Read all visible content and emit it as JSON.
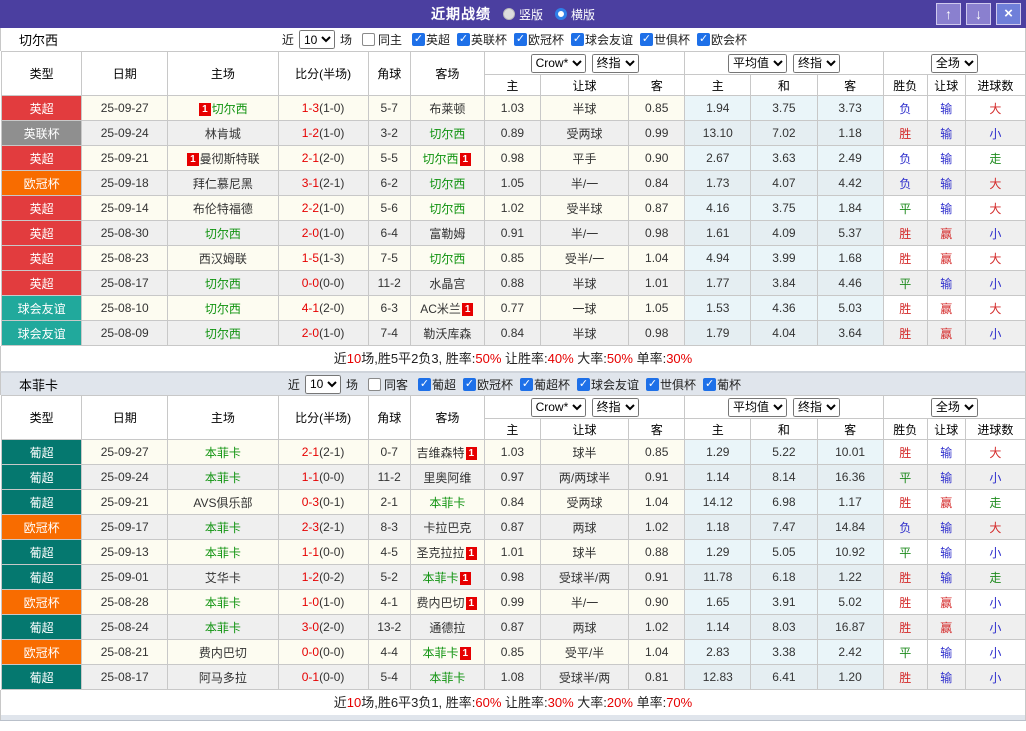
{
  "titlebar": {
    "title": "近期战绩",
    "radios": [
      {
        "label": "竖版",
        "selected": false
      },
      {
        "label": "横版",
        "selected": true
      }
    ],
    "buttons": [
      {
        "name": "up",
        "glyph": "↑"
      },
      {
        "name": "down",
        "glyph": "↓"
      },
      {
        "name": "close",
        "glyph": "×"
      }
    ]
  },
  "filter": {
    "prefix": "近",
    "matches_select": "10",
    "suffix": "场"
  },
  "table_header": {
    "static_cols": [
      "类型",
      "日期",
      "主场",
      "比分(半场)",
      "角球",
      "客场"
    ],
    "odds_group": {
      "selects": [
        "Crow*",
        "终指"
      ],
      "cols": [
        "主",
        "让球",
        "客"
      ]
    },
    "avg_group": {
      "selects": [
        "平均值",
        "终指"
      ],
      "cols": [
        "主",
        "和",
        "客"
      ]
    },
    "full_group": {
      "selects": [
        "全场"
      ],
      "cols": [
        "胜负",
        "让球",
        "进球数"
      ]
    }
  },
  "colors": {
    "titlebar": "#4b3fa0",
    "titlebar_button": "#8a80cf",
    "close_button": "#6f7fd9",
    "checkbox_blue": "#1e70e8",
    "focal_team_green": "#109310",
    "score_red": "#e60000",
    "red_card_badge": "#e60000",
    "summary_red": "#e60000"
  },
  "type_colors": {
    "英超": "#e23c3e",
    "英联杯": "#8f8f8f",
    "欧冠杯": "#f86c00",
    "球会友谊": "#21a99c",
    "葡超": "#05786f"
  },
  "result_colors": {
    "red": "#d42a2a",
    "blue": "#2d2dcc",
    "green": "#1d8a1d"
  },
  "result_color_map": {
    "胜": "red",
    "赢": "red",
    "大": "red",
    "负": "blue",
    "输": "blue",
    "小": "blue",
    "平": "green",
    "走": "green"
  },
  "sections": [
    {
      "team": "切尔西",
      "same_side_label": "同主",
      "leagues": [
        "英超",
        "英联杯",
        "欧冠杯",
        "球会友谊",
        "世俱杯",
        "欧会杯"
      ],
      "rows": [
        {
          "type": "英超",
          "date": "25-09-27",
          "home": {
            "name": "切尔西",
            "focal": true,
            "card_before": "1"
          },
          "score": "1-3",
          "half": "(1-0)",
          "corner": "5-7",
          "away": {
            "name": "布莱顿"
          },
          "odds": [
            "1.03",
            "半球",
            "0.85"
          ],
          "avg": [
            "1.94",
            "3.75",
            "3.73"
          ],
          "result": [
            "负",
            "输",
            "大"
          ]
        },
        {
          "type": "英联杯",
          "date": "25-09-24",
          "home": {
            "name": "林肯城"
          },
          "score": "1-2",
          "half": "(1-0)",
          "corner": "3-2",
          "away": {
            "name": "切尔西",
            "focal": true
          },
          "odds": [
            "0.89",
            "受两球",
            "0.99"
          ],
          "avg": [
            "13.10",
            "7.02",
            "1.18"
          ],
          "result": [
            "胜",
            "输",
            "小"
          ]
        },
        {
          "type": "英超",
          "date": "25-09-21",
          "home": {
            "name": "曼彻斯特联",
            "card_before": "1"
          },
          "score": "2-1",
          "half": "(2-0)",
          "corner": "5-5",
          "away": {
            "name": "切尔西",
            "focal": true,
            "card_after": "1"
          },
          "odds": [
            "0.98",
            "平手",
            "0.90"
          ],
          "avg": [
            "2.67",
            "3.63",
            "2.49"
          ],
          "result": [
            "负",
            "输",
            "走"
          ]
        },
        {
          "type": "欧冠杯",
          "date": "25-09-18",
          "home": {
            "name": "拜仁慕尼黑"
          },
          "score": "3-1",
          "half": "(2-1)",
          "corner": "6-2",
          "away": {
            "name": "切尔西",
            "focal": true
          },
          "odds": [
            "1.05",
            "半/一",
            "0.84"
          ],
          "avg": [
            "1.73",
            "4.07",
            "4.42"
          ],
          "result": [
            "负",
            "输",
            "大"
          ]
        },
        {
          "type": "英超",
          "date": "25-09-14",
          "home": {
            "name": "布伦特福德"
          },
          "score": "2-2",
          "half": "(1-0)",
          "corner": "5-6",
          "away": {
            "name": "切尔西",
            "focal": true
          },
          "odds": [
            "1.02",
            "受半球",
            "0.87"
          ],
          "avg": [
            "4.16",
            "3.75",
            "1.84"
          ],
          "result": [
            "平",
            "输",
            "大"
          ]
        },
        {
          "type": "英超",
          "date": "25-08-30",
          "home": {
            "name": "切尔西",
            "focal": true
          },
          "score": "2-0",
          "half": "(1-0)",
          "corner": "6-4",
          "away": {
            "name": "富勒姆"
          },
          "odds": [
            "0.91",
            "半/一",
            "0.98"
          ],
          "avg": [
            "1.61",
            "4.09",
            "5.37"
          ],
          "result": [
            "胜",
            "赢",
            "小"
          ]
        },
        {
          "type": "英超",
          "date": "25-08-23",
          "home": {
            "name": "西汉姆联"
          },
          "score": "1-5",
          "half": "(1-3)",
          "corner": "7-5",
          "away": {
            "name": "切尔西",
            "focal": true
          },
          "odds": [
            "0.85",
            "受半/一",
            "1.04"
          ],
          "avg": [
            "4.94",
            "3.99",
            "1.68"
          ],
          "result": [
            "胜",
            "赢",
            "大"
          ]
        },
        {
          "type": "英超",
          "date": "25-08-17",
          "home": {
            "name": "切尔西",
            "focal": true
          },
          "score": "0-0",
          "half": "(0-0)",
          "corner": "11-2",
          "away": {
            "name": "水晶宫"
          },
          "odds": [
            "0.88",
            "半球",
            "1.01"
          ],
          "avg": [
            "1.77",
            "3.84",
            "4.46"
          ],
          "result": [
            "平",
            "输",
            "小"
          ]
        },
        {
          "type": "球会友谊",
          "date": "25-08-10",
          "home": {
            "name": "切尔西",
            "focal": true
          },
          "score": "4-1",
          "half": "(2-0)",
          "corner": "6-3",
          "away": {
            "name": "AC米兰",
            "card_after": "1"
          },
          "odds": [
            "0.77",
            "一球",
            "1.05"
          ],
          "avg": [
            "1.53",
            "4.36",
            "5.03"
          ],
          "result": [
            "胜",
            "赢",
            "大"
          ]
        },
        {
          "type": "球会友谊",
          "date": "25-08-09",
          "home": {
            "name": "切尔西",
            "focal": true
          },
          "score": "2-0",
          "half": "(1-0)",
          "corner": "7-4",
          "away": {
            "name": "勒沃库森"
          },
          "odds": [
            "0.84",
            "半球",
            "0.98"
          ],
          "avg": [
            "1.79",
            "4.04",
            "3.64"
          ],
          "result": [
            "胜",
            "赢",
            "小"
          ]
        }
      ],
      "summary": [
        {
          "t": "近",
          "red": false
        },
        {
          "t": "10",
          "red": true
        },
        {
          "t": "场,胜5平2负3, 胜率:",
          "red": false
        },
        {
          "t": "50%",
          "red": true
        },
        {
          "t": " 让胜率:",
          "red": false
        },
        {
          "t": "40%",
          "red": true
        },
        {
          "t": " 大率:",
          "red": false
        },
        {
          "t": "50%",
          "red": true
        },
        {
          "t": " 单率:",
          "red": false
        },
        {
          "t": "30%",
          "red": true
        }
      ]
    },
    {
      "team": "本菲卡",
      "same_side_label": "同客",
      "leagues": [
        "葡超",
        "欧冠杯",
        "葡超杯",
        "球会友谊",
        "世俱杯",
        "葡杯"
      ],
      "rows": [
        {
          "type": "葡超",
          "date": "25-09-27",
          "home": {
            "name": "本菲卡",
            "focal": true
          },
          "score": "2-1",
          "half": "(2-1)",
          "corner": "0-7",
          "away": {
            "name": "吉维森特",
            "card_after": "1"
          },
          "odds": [
            "1.03",
            "球半",
            "0.85"
          ],
          "avg": [
            "1.29",
            "5.22",
            "10.01"
          ],
          "result": [
            "胜",
            "输",
            "大"
          ]
        },
        {
          "type": "葡超",
          "date": "25-09-24",
          "home": {
            "name": "本菲卡",
            "focal": true
          },
          "score": "1-1",
          "half": "(0-0)",
          "corner": "11-2",
          "away": {
            "name": "里奥阿维"
          },
          "odds": [
            "0.97",
            "两/两球半",
            "0.91"
          ],
          "avg": [
            "1.14",
            "8.14",
            "16.36"
          ],
          "result": [
            "平",
            "输",
            "小"
          ]
        },
        {
          "type": "葡超",
          "date": "25-09-21",
          "home": {
            "name": "AVS俱乐部"
          },
          "score": "0-3",
          "half": "(0-1)",
          "corner": "2-1",
          "away": {
            "name": "本菲卡",
            "focal": true
          },
          "odds": [
            "0.84",
            "受两球",
            "1.04"
          ],
          "avg": [
            "14.12",
            "6.98",
            "1.17"
          ],
          "result": [
            "胜",
            "赢",
            "走"
          ]
        },
        {
          "type": "欧冠杯",
          "date": "25-09-17",
          "home": {
            "name": "本菲卡",
            "focal": true
          },
          "score": "2-3",
          "half": "(2-1)",
          "corner": "8-3",
          "away": {
            "name": "卡拉巴克"
          },
          "odds": [
            "0.87",
            "两球",
            "1.02"
          ],
          "avg": [
            "1.18",
            "7.47",
            "14.84"
          ],
          "result": [
            "负",
            "输",
            "大"
          ]
        },
        {
          "type": "葡超",
          "date": "25-09-13",
          "home": {
            "name": "本菲卡",
            "focal": true
          },
          "score": "1-1",
          "half": "(0-0)",
          "corner": "4-5",
          "away": {
            "name": "圣克拉拉",
            "card_after": "1"
          },
          "odds": [
            "1.01",
            "球半",
            "0.88"
          ],
          "avg": [
            "1.29",
            "5.05",
            "10.92"
          ],
          "result": [
            "平",
            "输",
            "小"
          ]
        },
        {
          "type": "葡超",
          "date": "25-09-01",
          "home": {
            "name": "艾华卡"
          },
          "score": "1-2",
          "half": "(0-2)",
          "corner": "5-2",
          "away": {
            "name": "本菲卡",
            "focal": true,
            "card_after": "1"
          },
          "odds": [
            "0.98",
            "受球半/两",
            "0.91"
          ],
          "avg": [
            "11.78",
            "6.18",
            "1.22"
          ],
          "result": [
            "胜",
            "输",
            "走"
          ]
        },
        {
          "type": "欧冠杯",
          "date": "25-08-28",
          "home": {
            "name": "本菲卡",
            "focal": true
          },
          "score": "1-0",
          "half": "(1-0)",
          "corner": "4-1",
          "away": {
            "name": "费内巴切",
            "card_after": "1"
          },
          "odds": [
            "0.99",
            "半/一",
            "0.90"
          ],
          "avg": [
            "1.65",
            "3.91",
            "5.02"
          ],
          "result": [
            "胜",
            "赢",
            "小"
          ]
        },
        {
          "type": "葡超",
          "date": "25-08-24",
          "home": {
            "name": "本菲卡",
            "focal": true
          },
          "score": "3-0",
          "half": "(2-0)",
          "corner": "13-2",
          "away": {
            "name": "通德拉"
          },
          "odds": [
            "0.87",
            "两球",
            "1.02"
          ],
          "avg": [
            "1.14",
            "8.03",
            "16.87"
          ],
          "result": [
            "胜",
            "赢",
            "小"
          ]
        },
        {
          "type": "欧冠杯",
          "date": "25-08-21",
          "home": {
            "name": "费内巴切"
          },
          "score": "0-0",
          "half": "(0-0)",
          "corner": "4-4",
          "away": {
            "name": "本菲卡",
            "focal": true,
            "card_after": "1"
          },
          "odds": [
            "0.85",
            "受平/半",
            "1.04"
          ],
          "avg": [
            "2.83",
            "3.38",
            "2.42"
          ],
          "result": [
            "平",
            "输",
            "小"
          ]
        },
        {
          "type": "葡超",
          "date": "25-08-17",
          "home": {
            "name": "阿马多拉"
          },
          "score": "0-1",
          "half": "(0-0)",
          "corner": "5-4",
          "away": {
            "name": "本菲卡",
            "focal": true
          },
          "odds": [
            "1.08",
            "受球半/两",
            "0.81"
          ],
          "avg": [
            "12.83",
            "6.41",
            "1.20"
          ],
          "result": [
            "胜",
            "输",
            "小"
          ]
        }
      ],
      "summary": [
        {
          "t": "近",
          "red": false
        },
        {
          "t": "10",
          "red": true
        },
        {
          "t": "场,胜6平3负1, 胜率:",
          "red": false
        },
        {
          "t": "60%",
          "red": true
        },
        {
          "t": " 让胜率:",
          "red": false
        },
        {
          "t": "30%",
          "red": true
        },
        {
          "t": " 大率:",
          "red": false
        },
        {
          "t": "20%",
          "red": true
        },
        {
          "t": " 单率:",
          "red": false
        },
        {
          "t": "70%",
          "red": true
        }
      ]
    }
  ]
}
